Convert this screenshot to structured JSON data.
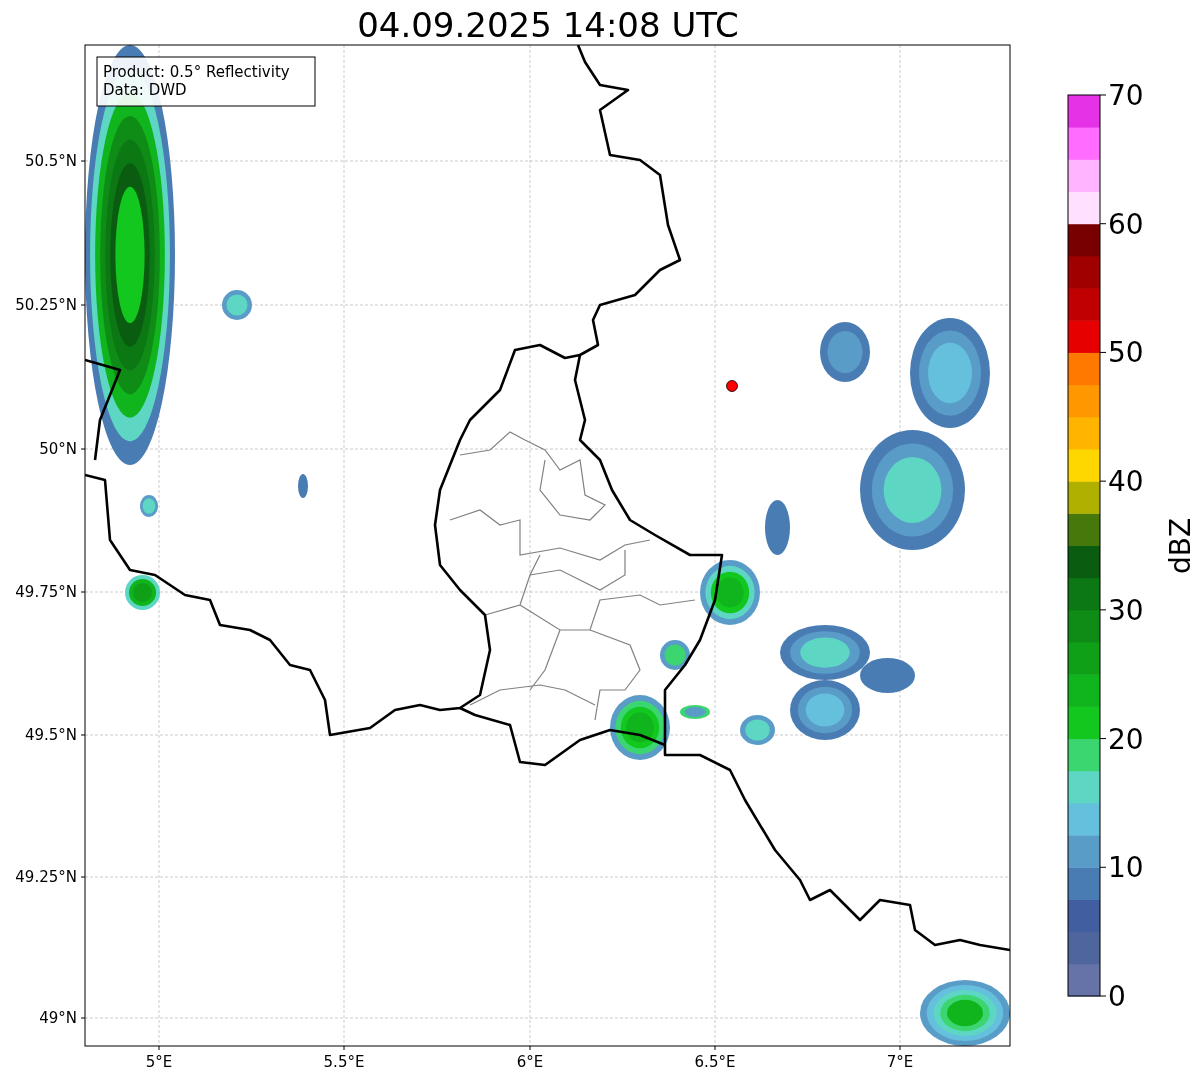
{
  "title": "04.09.2025 14:08 UTC",
  "map": {
    "info_box": [
      "Product: 0.5° Reflectivity",
      "Data: DWD"
    ],
    "lat_ticks": [
      "50.5°N",
      "50.25°N",
      "50°N",
      "49.75°N",
      "49.5°N",
      "49.25°N",
      "49°N"
    ],
    "lon_ticks": [
      "5°E",
      "5.5°E",
      "6°E",
      "6.5°E",
      "7°E"
    ]
  },
  "colorbar": {
    "label": "dBZ",
    "ticks": [
      "70",
      "60",
      "50",
      "40",
      "30",
      "20",
      "10",
      "0"
    ],
    "bands": [
      {
        "color": "#6673a8"
      },
      {
        "color": "#4f659e"
      },
      {
        "color": "#415ea0"
      },
      {
        "color": "#4a7cb4"
      },
      {
        "color": "#5a9cc8"
      },
      {
        "color": "#64c0dc"
      },
      {
        "color": "#5ed6c4"
      },
      {
        "color": "#3cd670"
      },
      {
        "color": "#12c81e"
      },
      {
        "color": "#10b41c"
      },
      {
        "color": "#0fa018"
      },
      {
        "color": "#0e8c16"
      },
      {
        "color": "#0c7814"
      },
      {
        "color": "#0a5c10"
      },
      {
        "color": "#46780c"
      },
      {
        "color": "#b0b000"
      },
      {
        "color": "#ffd700"
      },
      {
        "color": "#ffb400"
      },
      {
        "color": "#ff9800"
      },
      {
        "color": "#ff7800"
      },
      {
        "color": "#e60000"
      },
      {
        "color": "#c00000"
      },
      {
        "color": "#a00000"
      },
      {
        "color": "#780000"
      },
      {
        "color": "#ffe0ff"
      },
      {
        "color": "#ffb4ff"
      },
      {
        "color": "#ff6cff"
      },
      {
        "color": "#e632e6"
      }
    ]
  }
}
